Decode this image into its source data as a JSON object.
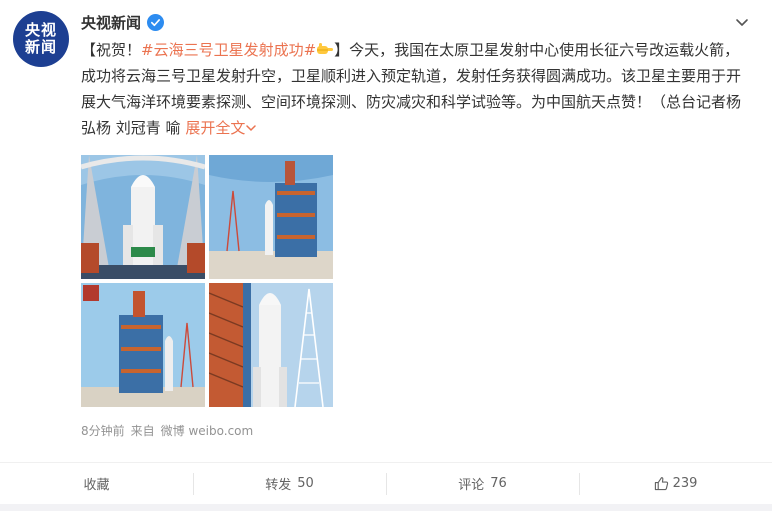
{
  "author": {
    "name": "央视新闻",
    "logo_top": "央视",
    "logo_bottom": "新闻"
  },
  "post": {
    "open_bracket": "【祝贺！",
    "hashtag": "#云海三号卫星发射成功#",
    "close_bracket": "】",
    "body": "今天，我国在太原卫星发射中心使用长征六号改运载火箭，成功将云海三号卫星发射升空，卫星顺利进入预定轨道，发射任务获得圆满成功。该卫星主要用于开展大气海洋环境要素探测、空间环境探测、防灾减灾和科学试验等。为中国航天点赞！（总台记者杨弘杨 刘冠青 喻",
    "expand_label": "展开全文"
  },
  "meta": {
    "time": "8分钟前",
    "from": "来自",
    "source": "微博 weibo.com"
  },
  "actions": {
    "favorite": "收藏",
    "repost_label": "转发",
    "repost_count": "50",
    "comment_label": "评论",
    "comment_count": "76",
    "like_count": "239"
  },
  "colors": {
    "link": "#eb7350",
    "verified": "#2d8cf0",
    "avatar_bg": "#1d3f92"
  },
  "icons": [
    "verified-badge-icon",
    "chevron-down-icon",
    "pointing-hand-emoji-icon",
    "thumbs-up-icon"
  ]
}
